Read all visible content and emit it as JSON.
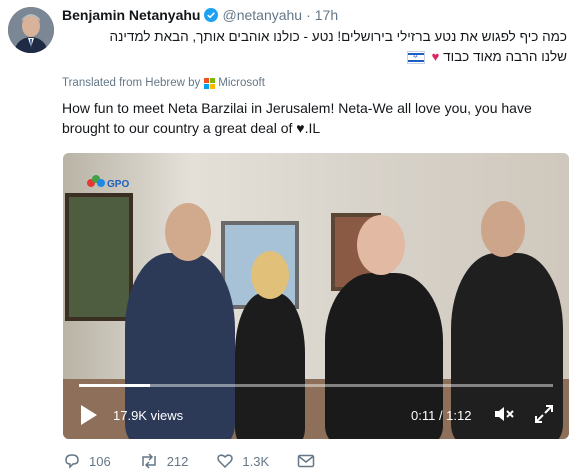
{
  "author": {
    "name": "Benjamin Netanyahu",
    "handle": "@netanyahu",
    "separator": "·",
    "time": "17h"
  },
  "tweet": {
    "hebrew_line1": "כמה כיף לפגוש את נטע ברזילי בירושלים! נטע - כולנו אוהבים אותך, הבאת למדינה",
    "hebrew_line2": "שלנו הרבה מאוד כבוד",
    "heart": "♥",
    "translated_prefix": "Translated from Hebrew by",
    "translated_provider": "Microsoft",
    "english": "How fun to meet Neta Barzilai in Jerusalem! Neta-We all love you, you have brought to our country a great deal of",
    "english_suffix": "♥.IL"
  },
  "video": {
    "watermark": "GPO",
    "views": "17.9K views",
    "timecode": "0:11 / 1:12",
    "progress_fraction": 0.15
  },
  "actions": {
    "replies": "106",
    "retweets": "212",
    "likes": "1.3K"
  },
  "colors": {
    "link_blue": "#1da1f2",
    "secondary_text": "#657786",
    "heart_red": "#e0245e"
  }
}
